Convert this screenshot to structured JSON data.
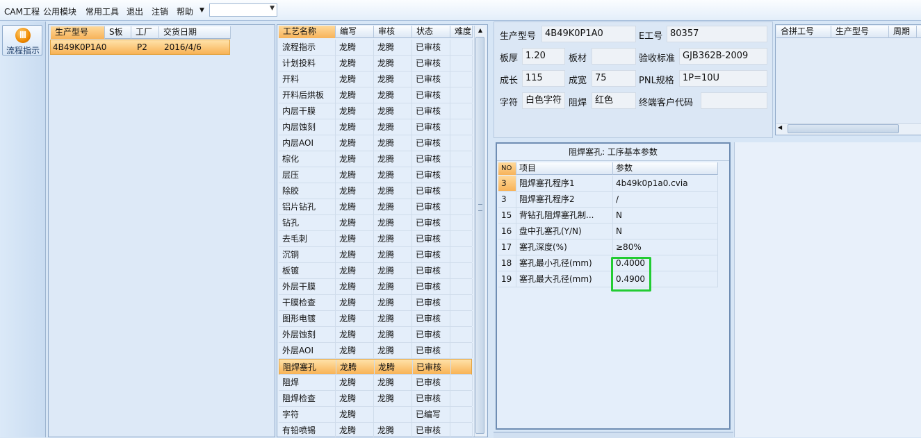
{
  "menu": {
    "items": [
      "CAM工程",
      "公用模块",
      "常用工具",
      "退出",
      "注销",
      "帮助"
    ],
    "combo_value": ""
  },
  "toolbar": {
    "flow_button_label": "流程指示"
  },
  "orders": {
    "headers": [
      "生产型号",
      "S板",
      "工厂",
      "交货日期"
    ],
    "rows": [
      {
        "model": "4B49K0P1A0",
        "s_board": "",
        "factory": "P2",
        "date": "2016/4/6"
      }
    ]
  },
  "processes": {
    "headers": [
      "工艺名称",
      "编写",
      "审核",
      "状态",
      "难度"
    ],
    "rows": [
      [
        "流程指示",
        "龙腾",
        "龙腾",
        "已审核"
      ],
      [
        "计划投料",
        "龙腾",
        "龙腾",
        "已审核"
      ],
      [
        "开料",
        "龙腾",
        "龙腾",
        "已审核"
      ],
      [
        "开料后烘板",
        "龙腾",
        "龙腾",
        "已审核"
      ],
      [
        "内层干膜",
        "龙腾",
        "龙腾",
        "已审核"
      ],
      [
        "内层蚀刻",
        "龙腾",
        "龙腾",
        "已审核"
      ],
      [
        "内层AOI",
        "龙腾",
        "龙腾",
        "已审核"
      ],
      [
        "棕化",
        "龙腾",
        "龙腾",
        "已审核"
      ],
      [
        "层压",
        "龙腾",
        "龙腾",
        "已审核"
      ],
      [
        "除胶",
        "龙腾",
        "龙腾",
        "已审核"
      ],
      [
        "铝片钻孔",
        "龙腾",
        "龙腾",
        "已审核"
      ],
      [
        "钻孔",
        "龙腾",
        "龙腾",
        "已审核"
      ],
      [
        "去毛刺",
        "龙腾",
        "龙腾",
        "已审核"
      ],
      [
        "沉铜",
        "龙腾",
        "龙腾",
        "已审核"
      ],
      [
        "板镀",
        "龙腾",
        "龙腾",
        "已审核"
      ],
      [
        "外层干膜",
        "龙腾",
        "龙腾",
        "已审核"
      ],
      [
        "干膜检查",
        "龙腾",
        "龙腾",
        "已审核"
      ],
      [
        "图形电镀",
        "龙腾",
        "龙腾",
        "已审核"
      ],
      [
        "外层蚀刻",
        "龙腾",
        "龙腾",
        "已审核"
      ],
      [
        "外层AOI",
        "龙腾",
        "龙腾",
        "已审核"
      ],
      [
        "阻焊塞孔",
        "龙腾",
        "龙腾",
        "已审核"
      ],
      [
        "阻焊",
        "龙腾",
        "龙腾",
        "已审核"
      ],
      [
        "阻焊检查",
        "龙腾",
        "龙腾",
        "已审核"
      ],
      [
        "字符",
        "龙腾",
        "",
        "已编写"
      ],
      [
        "有铅喷锡",
        "龙腾",
        "龙腾",
        "已审核"
      ]
    ],
    "selected_index": 20
  },
  "info": {
    "model_label": "生产型号",
    "model_value": "4B49K0P1A0",
    "eno_label": "E工号",
    "eno_value": "80357",
    "thickness_label": "板厚",
    "thickness_value": "1.20",
    "material_label": "板材",
    "material_value": "",
    "standard_label": "验收标准",
    "standard_value": "GJB362B-2009",
    "length_label": "成长",
    "length_value": "115",
    "width_label": "成宽",
    "width_value": "75",
    "pnl_label": "PNL规格",
    "pnl_value": "1P=10U",
    "char_label": "字符",
    "char_value": "白色字符",
    "mask_label": "阻焊",
    "mask_value": "红色",
    "customer_label": "终端客户代码",
    "customer_value": ""
  },
  "merge": {
    "headers": [
      "合拼工号",
      "生产型号",
      "周期"
    ]
  },
  "params": {
    "title": "阻焊塞孔: 工序基本参数",
    "headers": [
      "NO",
      "项目",
      "参数"
    ],
    "rows": [
      [
        "3",
        "阻焊塞孔程序1",
        "4b49k0p1a0.cvia"
      ],
      [
        "3",
        "阻焊塞孔程序2",
        "/"
      ],
      [
        "15",
        "背钻孔阻焊塞孔制...",
        "N"
      ],
      [
        "16",
        "盘中孔塞孔(Y/N)",
        "N"
      ],
      [
        "17",
        "塞孔深度(%)",
        "≥80%"
      ],
      [
        "18",
        "塞孔最小孔径(mm)",
        "0.4000"
      ],
      [
        "19",
        "塞孔最大孔径(mm)",
        "0.4900"
      ]
    ]
  },
  "colors": {
    "highlight_box": "#22cc33",
    "selection": "#f8b255"
  }
}
